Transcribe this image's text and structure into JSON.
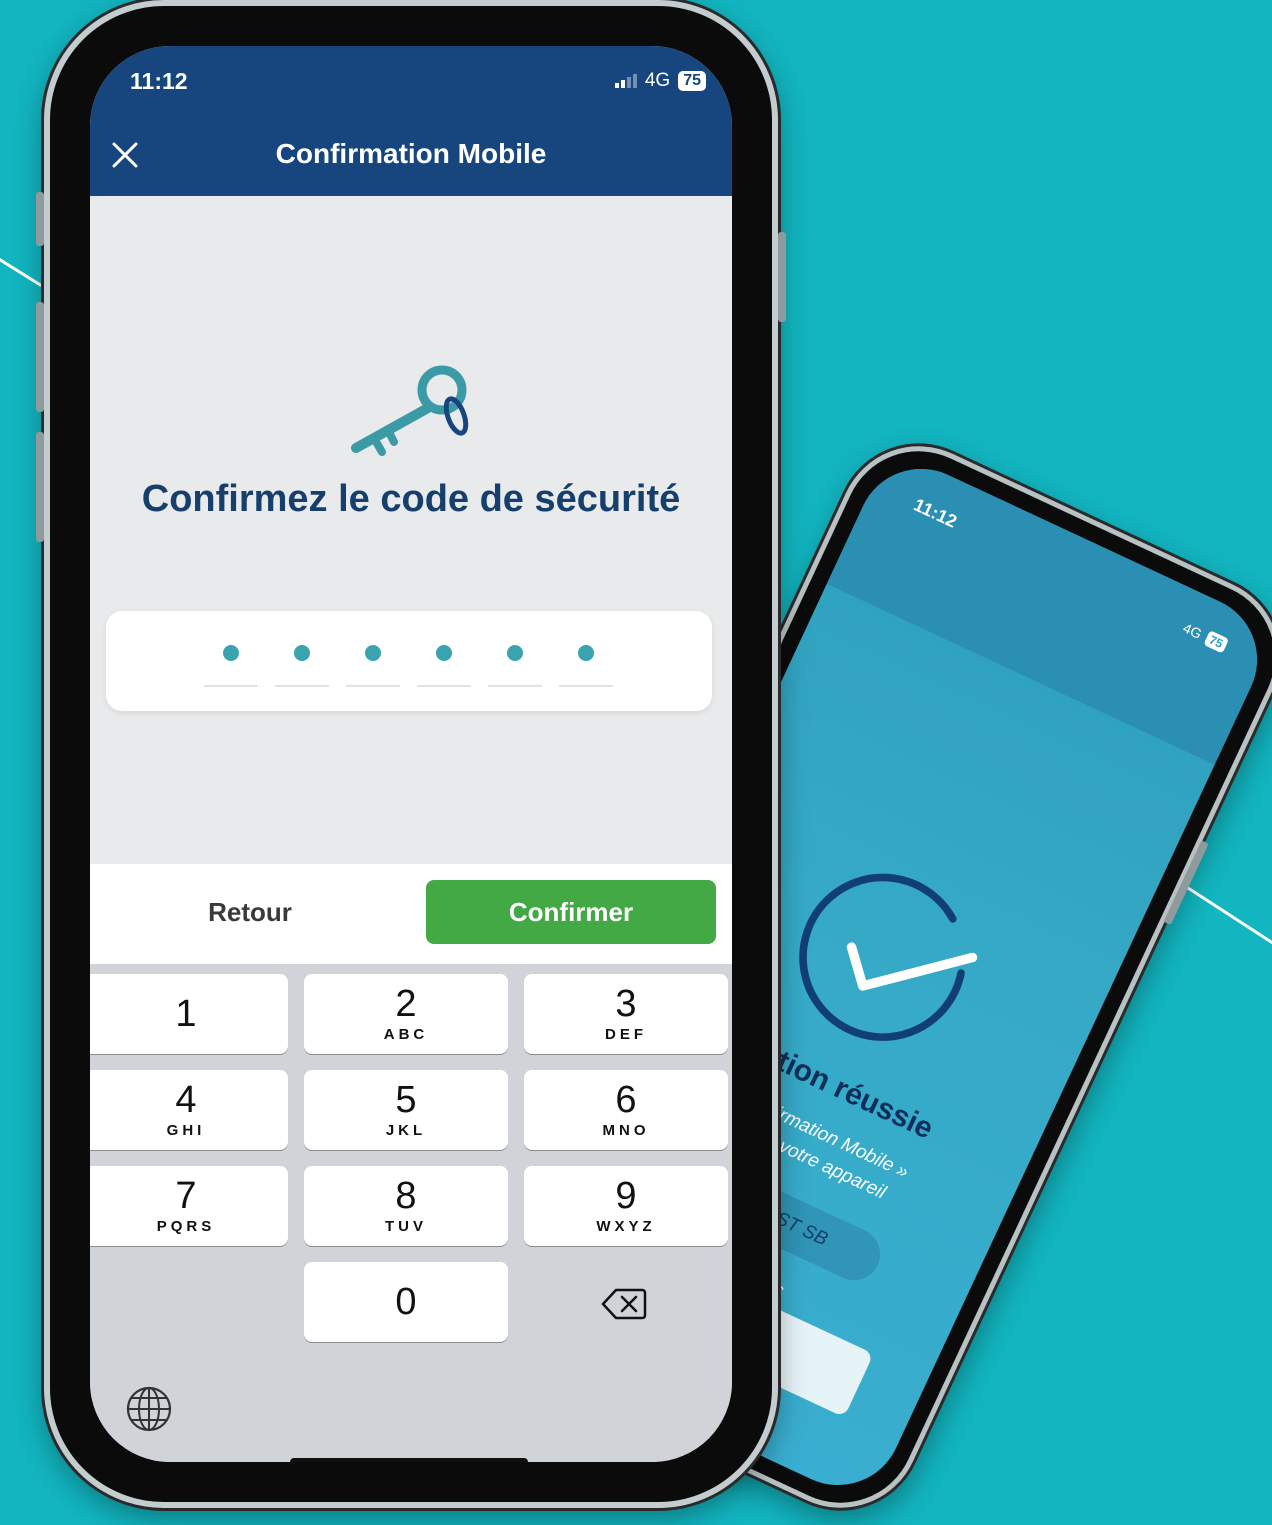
{
  "colors": {
    "background": "#12b5c0",
    "nav_bar": "#17467e",
    "headline": "#163f6e",
    "confirm_button": "#43a945",
    "code_dot": "#3aa3b0"
  },
  "status_bar": {
    "time": "11:12",
    "network": "4G",
    "battery": "75"
  },
  "nav": {
    "close_icon": "close-icon",
    "title": "Confirmation Mobile"
  },
  "security": {
    "icon": "key-icon",
    "headline": "Confirmez le code de sécurité",
    "code_length": 6,
    "filled_digits": 6
  },
  "actions": {
    "back_label": "Retour",
    "confirm_label": "Confirmer"
  },
  "keypad": {
    "keys": [
      {
        "digit": "1",
        "letters": ""
      },
      {
        "digit": "2",
        "letters": "ABC"
      },
      {
        "digit": "3",
        "letters": "DEF"
      },
      {
        "digit": "4",
        "letters": "GHI"
      },
      {
        "digit": "5",
        "letters": "JKL"
      },
      {
        "digit": "6",
        "letters": "MNO"
      },
      {
        "digit": "7",
        "letters": "PQRS"
      },
      {
        "digit": "8",
        "letters": "TUV"
      },
      {
        "digit": "9",
        "letters": "WXYZ"
      },
      {
        "digit": "0",
        "letters": ""
      }
    ],
    "backspace_icon": "backspace-icon",
    "globe_icon": "globe-icon"
  },
  "secondary_phone": {
    "status_time": "11:12",
    "network": "4G",
    "battery": "75",
    "icon": "check-circle-icon",
    "title": "cription réussie",
    "lines": [
      "é « Confirmation Mobile »",
      "nelle sur votre appareil"
    ],
    "pill": "de M TEST SB",
    "notes": [
      "érifications",
      "effectuées"
    ]
  }
}
